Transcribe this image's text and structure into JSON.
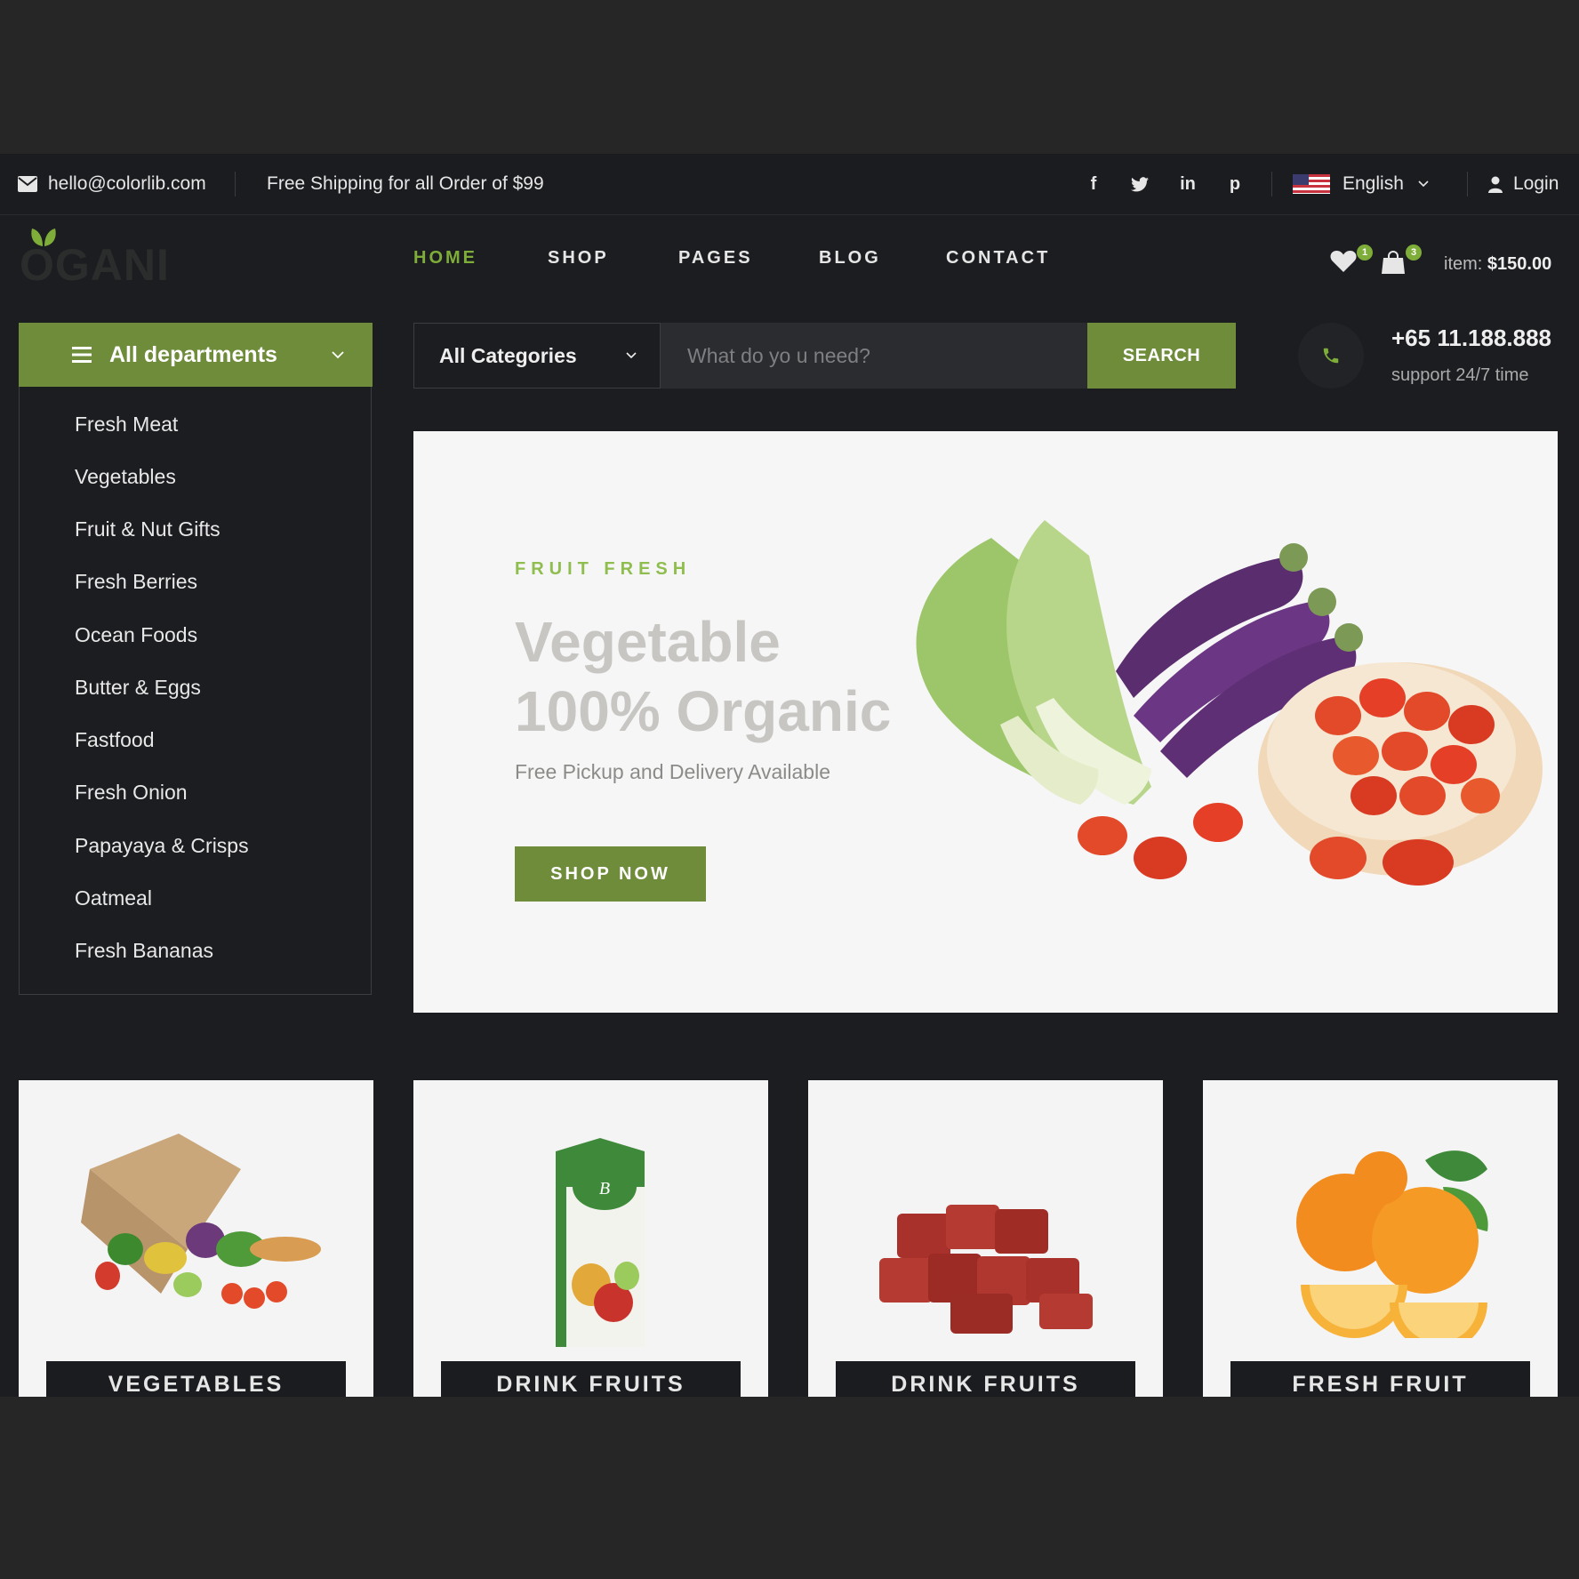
{
  "topbar": {
    "email": "hello@colorlib.com",
    "shipping": "Free Shipping for all Order of $99",
    "social": [
      "f",
      "t",
      "in",
      "p"
    ],
    "language": "English",
    "login": "Login"
  },
  "header": {
    "logo": "OGANI",
    "nav": [
      "HOME",
      "SHOP",
      "PAGES",
      "BLOG",
      "CONTACT"
    ],
    "wishlist_count": "1",
    "cart_count": "3",
    "item_label": "item:",
    "item_total": "$150.00"
  },
  "departments": {
    "title": "All departments",
    "items": [
      "Fresh Meat",
      "Vegetables",
      "Fruit & Nut Gifts",
      "Fresh Berries",
      "Ocean Foods",
      "Butter & Eggs",
      "Fastfood",
      "Fresh Onion",
      "Papayaya & Crisps",
      "Oatmeal",
      "Fresh Bananas"
    ]
  },
  "search": {
    "category": "All Categories",
    "placeholder": "What do yo u need?",
    "button": "SEARCH"
  },
  "contact": {
    "phone": "+65 11.188.888",
    "support": "support 24/7 time"
  },
  "hero": {
    "kicker": "FRUIT FRESH",
    "title_line1": "Vegetable",
    "title_line2": "100% Organic",
    "subtitle": "Free Pickup and Delivery Available",
    "button": "SHOP NOW"
  },
  "categories": [
    "VEGETABLES",
    "DRINK FRUITS",
    "DRINK FRUITS",
    "FRESH FRUIT"
  ],
  "colors": {
    "accent": "#7fad39",
    "button": "#6e8c3a",
    "background": "#1c1d20"
  }
}
